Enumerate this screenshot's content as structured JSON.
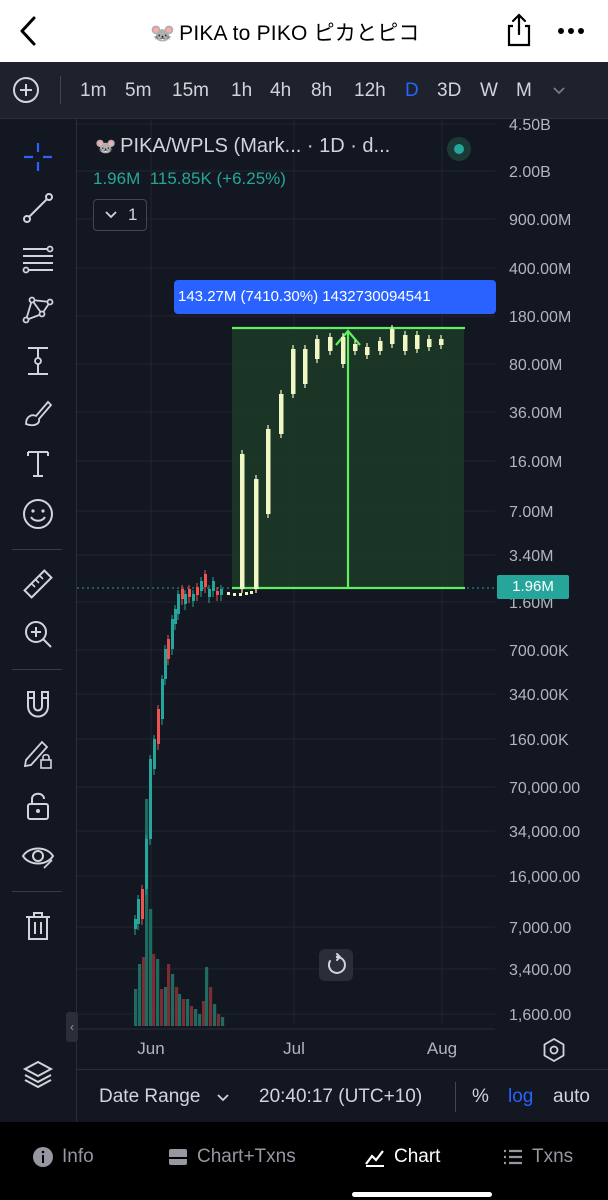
{
  "header": {
    "back_icon": "chevron-left-icon",
    "emoji": "🐭",
    "title": "PIKA to PIKO ピカとピコ",
    "share_icon": "share-icon",
    "more_icon": "more-horizontal-icon"
  },
  "timeframes": {
    "items": [
      "1m",
      "5m",
      "15m",
      "1h",
      "4h",
      "8h",
      "12h",
      "D",
      "3D",
      "W",
      "M"
    ],
    "active": "D"
  },
  "tools": [
    "crosshair-icon",
    "trend-line-icon",
    "fib-retracement-icon",
    "pattern-icon",
    "measure-icon",
    "brush-icon",
    "text-icon",
    "emoji-icon",
    "ruler-icon",
    "zoom-in-icon",
    "magnet-icon",
    "lock-drawing-icon",
    "unlock-icon",
    "eye-icon",
    "trash-icon",
    "layers-icon"
  ],
  "legend": {
    "symbol": "PIKA/WPLS (Mark... · 1D · d...",
    "price": "1.96M",
    "change": "115.85K (+6.25%)",
    "collapse_count": "1"
  },
  "measure_label": "143.27M (7410.30%) 1432730094541",
  "price_badge": "1.96M",
  "colors": {
    "up": "#26a69a",
    "down": "#ef5350",
    "highlight_candle": "#f0f6c4",
    "measure": "#5ef05e",
    "accent": "#2962ff"
  },
  "chart_data": {
    "type": "candlestick",
    "scale": "log",
    "y_ticks": [
      "4.50B",
      "2.00B",
      "900.00M",
      "400.00M",
      "180.00M",
      "80.00M",
      "36.00M",
      "16.00M",
      "7.00M",
      "3.40M",
      "1.60M",
      "700.00K",
      "340.00K",
      "160.00K",
      "70,000.00",
      "34,000.00",
      "16,000.00",
      "7,000.00",
      "3,400.00",
      "1,600.00"
    ],
    "x_ticks": [
      "Jun",
      "Jul",
      "Aug"
    ],
    "last_price": "1.96M"
  },
  "bottom_bar": {
    "date_range": "Date Range",
    "time": "20:40:17 (UTC+10)",
    "percent": "%",
    "log": "log",
    "auto": "auto"
  },
  "tabs": [
    {
      "label": "Info",
      "icon": "info-icon"
    },
    {
      "label": "Chart+Txns",
      "icon": "chart-txns-icon"
    },
    {
      "label": "Chart",
      "icon": "chart-icon"
    },
    {
      "label": "Txns",
      "icon": "list-icon"
    }
  ],
  "active_tab": "Chart"
}
